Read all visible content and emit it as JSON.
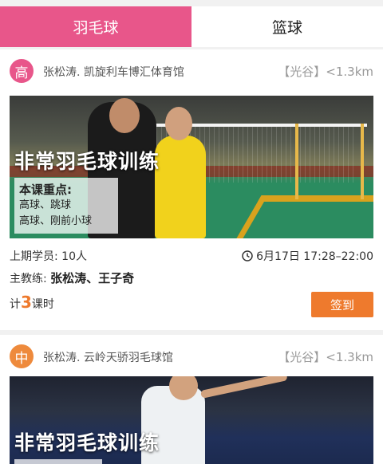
{
  "tabs": [
    {
      "label": "羽毛球",
      "active": true
    },
    {
      "label": "篮球",
      "active": false
    }
  ],
  "colors": {
    "accent": "#e8568a",
    "button": "#ee7a2d",
    "level_intermediate": "#ee8a3c"
  },
  "courses": [
    {
      "level": "高",
      "venue": "张松涛. 凯旋利车博汇体育馆",
      "distance": "【光谷】<1.3km",
      "title": "非常羽毛球训练",
      "focus_title": "本课重点:",
      "focus_items": [
        "高球、跳球",
        "高球、刚前小球"
      ],
      "last_students": "上期学员: 10人",
      "time": "6月17日 17:28–22:00",
      "coach_label": "主教练: ",
      "coaches": "张松涛、王子奇",
      "sessions_prefix": "计",
      "sessions_count": "3",
      "sessions_suffix": "课时",
      "signin_label": "签到"
    },
    {
      "level": "中",
      "venue": "张松涛. 云岭天骄羽毛球馆",
      "distance": "【光谷】<1.3km",
      "title": "非常羽毛球训练"
    }
  ]
}
